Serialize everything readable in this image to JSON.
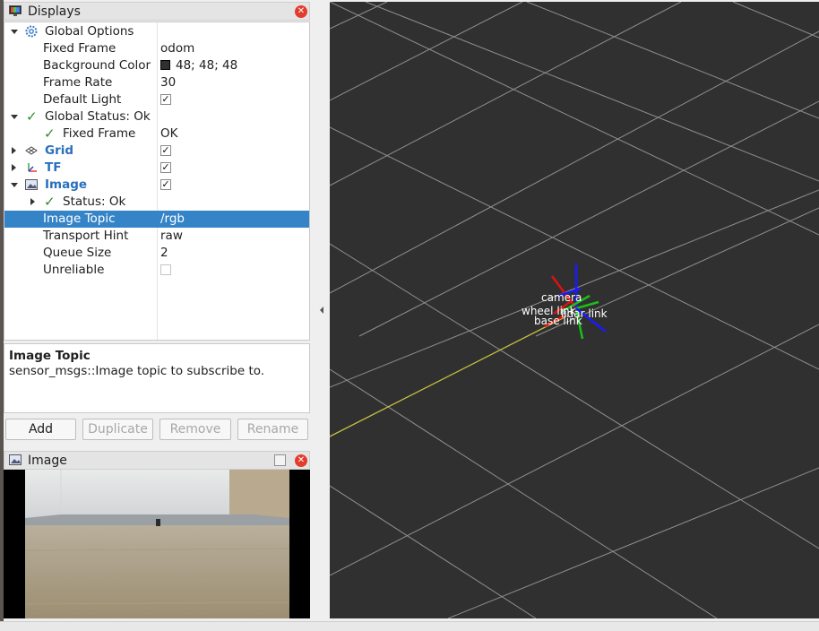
{
  "displays_panel": {
    "title": "Displays",
    "rows": [
      {
        "name": "global-options",
        "label": "Global Options",
        "value": ""
      },
      {
        "name": "fixed-frame",
        "label": "Fixed Frame",
        "value": "odom"
      },
      {
        "name": "background-color",
        "label": "Background Color",
        "value": "48; 48; 48"
      },
      {
        "name": "frame-rate",
        "label": "Frame Rate",
        "value": "30"
      },
      {
        "name": "default-light",
        "label": "Default Light",
        "value": ""
      },
      {
        "name": "global-status",
        "label": "Global Status: Ok",
        "value": ""
      },
      {
        "name": "status-fixed-frame",
        "label": "Fixed Frame",
        "value": "OK"
      },
      {
        "name": "grid",
        "label": "Grid",
        "value": ""
      },
      {
        "name": "tf",
        "label": "TF",
        "value": ""
      },
      {
        "name": "image",
        "label": "Image",
        "value": ""
      },
      {
        "name": "image-status",
        "label": "Status: Ok",
        "value": ""
      },
      {
        "name": "image-topic",
        "label": "Image Topic",
        "value": "/rgb"
      },
      {
        "name": "transport-hint",
        "label": "Transport Hint",
        "value": "raw"
      },
      {
        "name": "queue-size",
        "label": "Queue Size",
        "value": "2"
      },
      {
        "name": "unreliable",
        "label": "Unreliable",
        "value": ""
      }
    ],
    "background_color_hex": "#303030",
    "selection_color": "#3584c8"
  },
  "description": {
    "title": "Image Topic",
    "text": "sensor_msgs::Image topic to subscribe to."
  },
  "buttons": {
    "add": "Add",
    "duplicate": "Duplicate",
    "remove": "Remove",
    "rename": "Rename"
  },
  "image_panel": {
    "title": "Image"
  },
  "view3d": {
    "frame_labels": [
      "camera",
      "wheel link",
      "base link",
      "lidar link"
    ]
  }
}
